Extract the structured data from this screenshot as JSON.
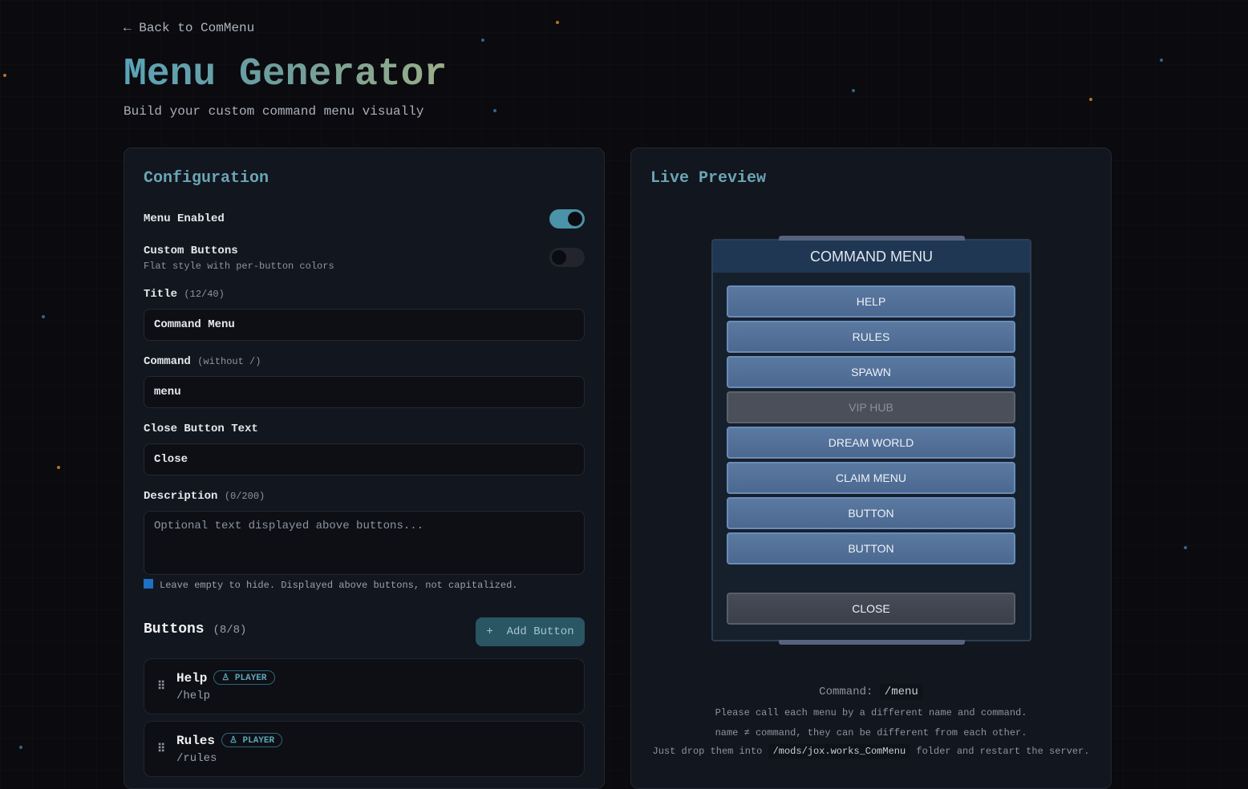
{
  "header": {
    "back_label": "Back to ComMenu",
    "title": "Menu Generator",
    "subtitle": "Build your custom command menu visually"
  },
  "config": {
    "title": "Configuration",
    "menu_enabled": {
      "label": "Menu Enabled",
      "on": true
    },
    "custom_buttons": {
      "label": "Custom Buttons",
      "hint": "Flat style with per-button colors",
      "on": false
    },
    "title_field": {
      "label": "Title",
      "meta": "(12/40)",
      "value": "Command Menu"
    },
    "command_field": {
      "label": "Command",
      "meta": "(without /)",
      "value": "menu"
    },
    "close_field": {
      "label": "Close Button Text",
      "value": "Close"
    },
    "description_field": {
      "label": "Description",
      "meta": "(0/200)",
      "placeholder": "Optional text displayed above buttons...",
      "info": "Leave empty to hide. Displayed above buttons, not capitalized."
    },
    "buttons": {
      "title": "Buttons",
      "count": "(8/8)",
      "add_label": "Add Button",
      "items": [
        {
          "name": "Help",
          "role": "PLAYER",
          "command": "/help"
        },
        {
          "name": "Rules",
          "role": "PLAYER",
          "command": "/rules"
        }
      ]
    }
  },
  "preview": {
    "title": "Live Preview",
    "menu_title": "COMMAND MENU",
    "buttons": [
      "HELP",
      "RULES",
      "SPAWN",
      "VIP HUB",
      "DREAM WORLD",
      "CLAIM MENU",
      "BUTTON",
      "BUTTON"
    ],
    "close": "CLOSE",
    "command_label": "Command:",
    "command_value": "/menu",
    "note1": "Please call each menu by a different name and command.",
    "note2": "name ≠ command, they can be different from each other.",
    "note3_a": "Just drop them into",
    "note3_path": "/mods/jox.works_ComMenu",
    "note3_b": "folder and restart the server."
  }
}
